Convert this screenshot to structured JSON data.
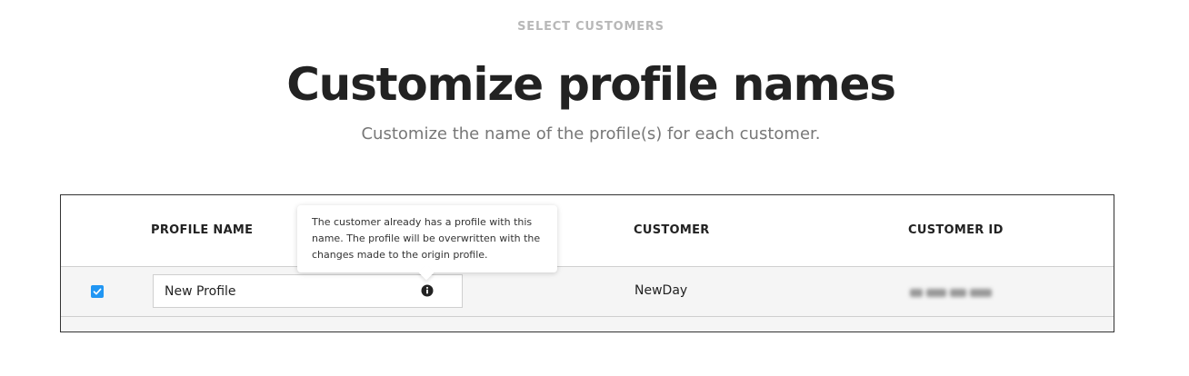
{
  "header": {
    "eyebrow": "SELECT CUSTOMERS",
    "title": "Customize profile names",
    "subtitle": "Customize the name of the profile(s) for each customer."
  },
  "table": {
    "columns": {
      "profile_name": "PROFILE NAME",
      "customer": "CUSTOMER",
      "customer_id": "CUSTOMER ID"
    },
    "rows": [
      {
        "checked": true,
        "profile_name": "New Profile",
        "customer": "NewDay",
        "customer_id_blurred": true
      }
    ]
  },
  "tooltip": {
    "text": "The customer already has a profile with this name. The profile will be overwritten with the changes made to the origin profile."
  },
  "colors": {
    "accent": "#2196f3",
    "row_background": "#f5f5f5",
    "muted_text": "#b8b8b8",
    "subtitle_text": "#777777"
  },
  "icons": {
    "checkbox": "checkbox-checked-icon",
    "info": "info-icon"
  }
}
